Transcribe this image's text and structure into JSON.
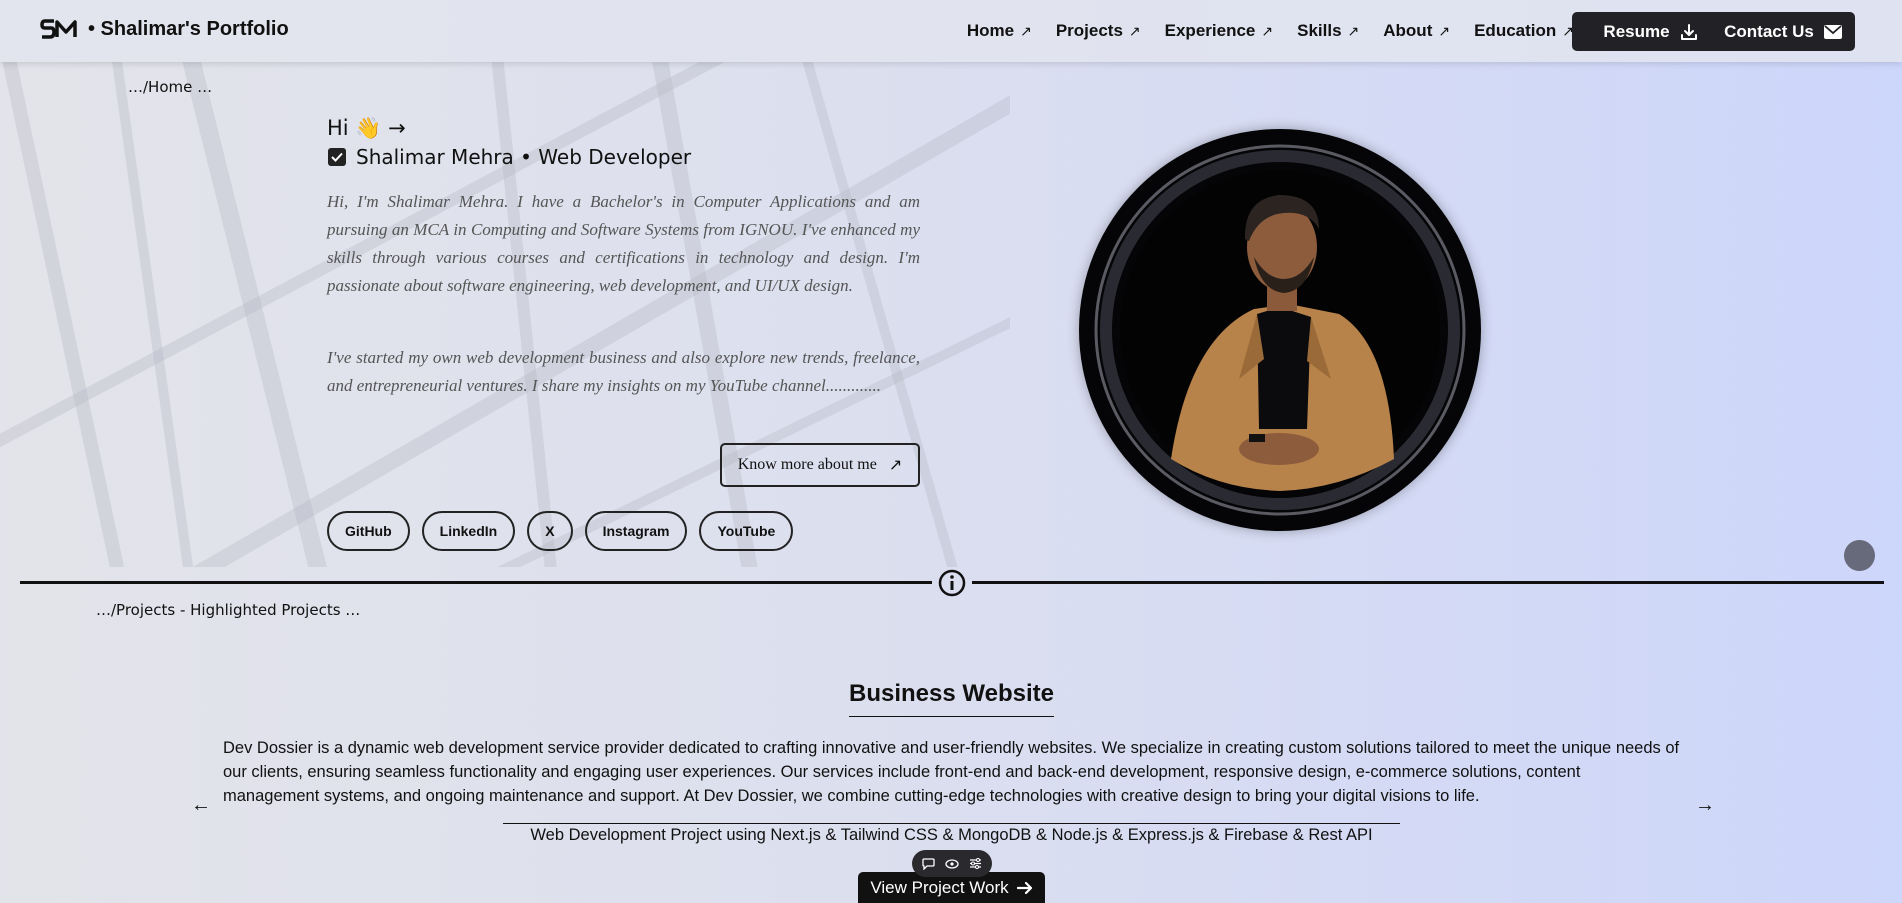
{
  "header": {
    "brand": "• Shalimar's Portfolio",
    "nav": [
      {
        "label": "Home",
        "arrow": "↗"
      },
      {
        "label": "Projects",
        "arrow": "↗"
      },
      {
        "label": "Experience",
        "arrow": "↗"
      },
      {
        "label": "Skills",
        "arrow": "↗"
      },
      {
        "label": "About",
        "arrow": "↗"
      },
      {
        "label": "Education",
        "arrow": "↗"
      }
    ],
    "resume_label": "Resume",
    "contact_label": "Contact Us"
  },
  "hero": {
    "breadcrumb": "…/Home …",
    "greeting": "Hi 👋 →",
    "role": "Shalimar Mehra • Web Developer",
    "para1": "Hi, I'm Shalimar Mehra. I have a Bachelor's in Computer Applications and am pursuing an MCA in Computing and Software Systems from IGNOU. I've enhanced my skills through various courses and certifications in technology and design. I'm passionate about software engineering, web development, and UI/UX design.",
    "para2": "I've started my own web development business and also explore new trends, freelance, and entrepreneurial ventures. I share my insights on my YouTube channel.............",
    "know_more_label": "Know more about me",
    "know_more_arrow": "↗",
    "socials": [
      "GitHub",
      "LinkedIn",
      "X",
      "Instagram",
      "YouTube"
    ]
  },
  "projects": {
    "breadcrumb": "…/Projects - Highlighted Projects …",
    "title": "Business Website",
    "description": "Dev Dossier is a dynamic web development service provider dedicated to crafting innovative and user-friendly websites. We specialize in creating custom solutions tailored to meet the unique needs of our clients, ensuring seamless functionality and engaging user experiences. Our services include front-end and back-end development, responsive design, e-commerce solutions, content management systems, and ongoing maintenance and support. At Dev Dossier, we combine cutting-edge technologies with creative design to bring your digital visions to life.",
    "tech": "Web Development Project using Next.js & Tailwind CSS & MongoDB & Node.js & Express.js & Firebase & Rest API",
    "view_label": "View Project Work",
    "prev_arrow": "←",
    "next_arrow": "→"
  }
}
